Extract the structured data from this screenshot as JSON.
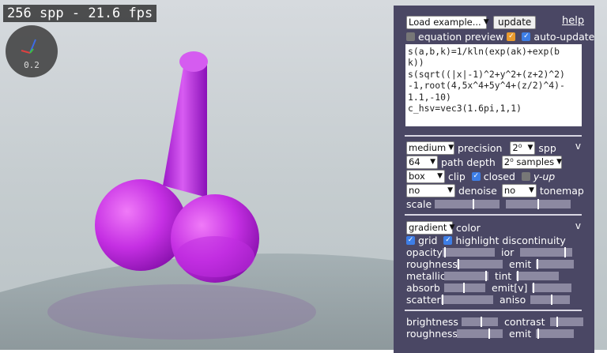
{
  "stats": {
    "fps_text": "256 spp - 21.6 fps"
  },
  "gizmo": {
    "value": "0.2"
  },
  "toolbar": {
    "load_example": "Load example...",
    "update_label": "update",
    "help_label": "help"
  },
  "options": {
    "equation_preview": "equation preview",
    "auto_update": "auto-update"
  },
  "code_lines": [
    "s(a,b,k)=1/kln(exp(ak)+exp(b",
    "k))",
    "s(sqrt((|x|-1)^2+y^2+(z+2)^2)",
    "-1,root(4,5x^4+5y^4+(z/2)^4)-",
    "1.1,-10)",
    "c_hsv=vec3(1.6pi,1,1)"
  ],
  "render": {
    "precision_value": "medium",
    "precision_label": "precision",
    "spp_value": "2⁰",
    "spp_label": "spp",
    "depth_value": "64",
    "depth_label": "path depth",
    "samples_value": "2⁰ samples",
    "clip_value": "box",
    "clip_label": "clip",
    "closed_label": "closed",
    "yup_label": "y-up",
    "denoise_value": "no",
    "denoise_label": "denoise",
    "tonemap_value": "no",
    "tonemap_label": "tonemap",
    "scale_label": "scale",
    "collapse": "v"
  },
  "material": {
    "color_mode": "gradient",
    "color_label": "color",
    "grid_label": "grid",
    "highlight_label": "highlight discontinuity",
    "opacity": "opacity",
    "ior": "ior",
    "roughness": "roughness",
    "emit": "emit",
    "metallic": "metallic",
    "tint": "tint",
    "absorb": "absorb",
    "emitv": "emit[v]",
    "scatter": "scatter",
    "aniso": "aniso",
    "collapse": "v"
  },
  "lighting": {
    "brightness": "brightness",
    "contrast": "contrast",
    "roughness": "roughness",
    "emit": "emit",
    "collapse": "v"
  },
  "colors": {
    "panel_bg": "#4a4764",
    "shape": "#b31ee0",
    "accent": "#3d7ee6"
  }
}
